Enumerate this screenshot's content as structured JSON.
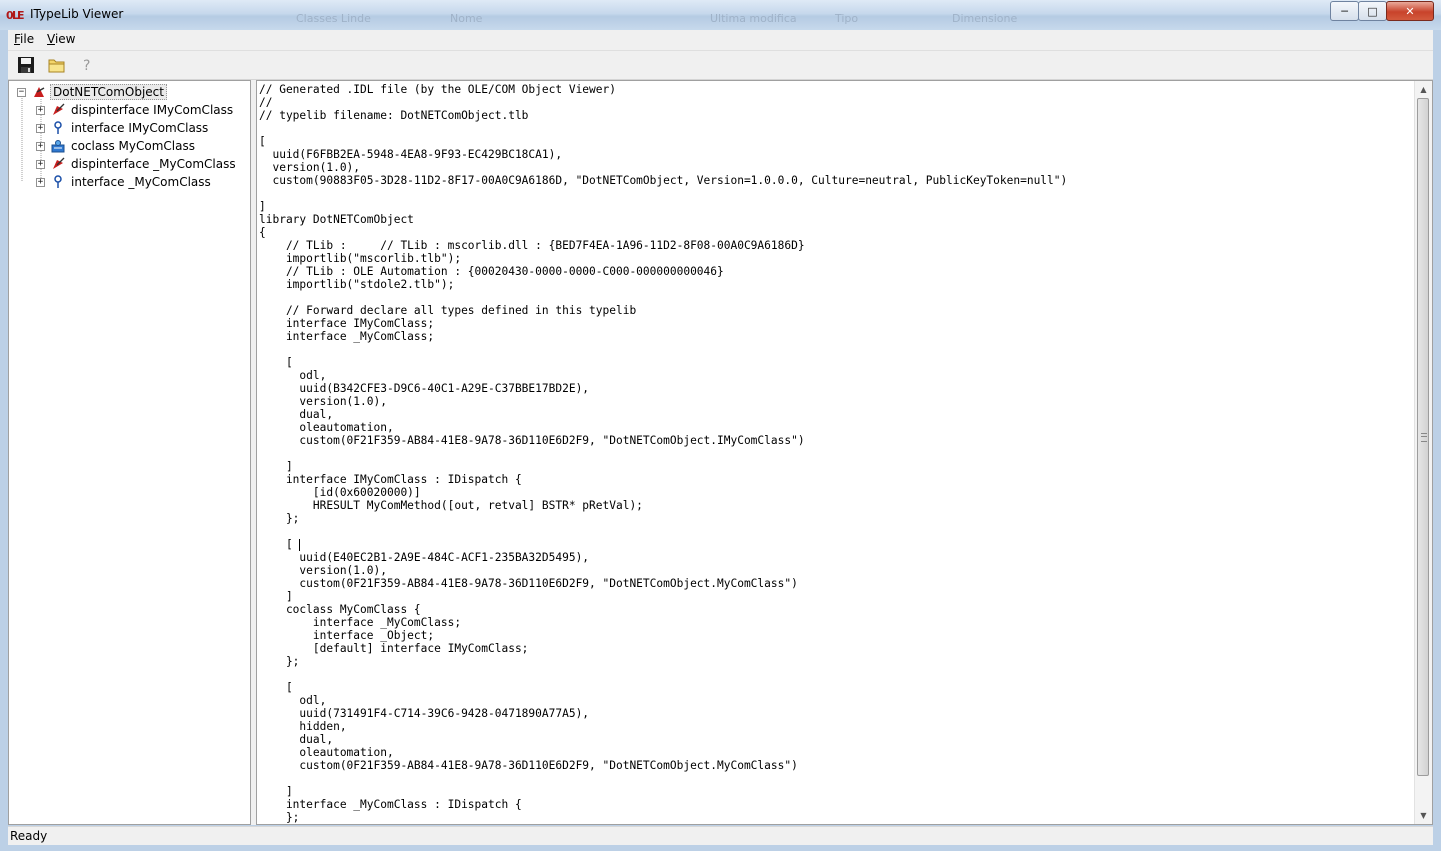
{
  "window": {
    "title": "ITypeLib Viewer",
    "buttons": {
      "minimize": "─",
      "maximize": "□",
      "close": "✕"
    },
    "background_ghost": [
      "Classes Linde",
      "Nome",
      "Ultima modifica",
      "Tipo",
      "Dimensione"
    ]
  },
  "menu": {
    "items": [
      {
        "accel": "F",
        "rest": "ile"
      },
      {
        "accel": "V",
        "rest": "iew"
      }
    ]
  },
  "toolbar": {
    "icons": [
      "save-icon",
      "open-folder-icon",
      "help-icon"
    ]
  },
  "tree": {
    "root": {
      "label": "DotNETComObject",
      "expander": "−",
      "icon": "typelib-icon"
    },
    "children": [
      {
        "label": "dispinterface IMyComClass",
        "expander": "+",
        "icon": "dispinterface-icon"
      },
      {
        "label": "interface IMyComClass",
        "expander": "+",
        "icon": "interface-icon"
      },
      {
        "label": "coclass MyComClass",
        "expander": "+",
        "icon": "coclass-icon"
      },
      {
        "label": "dispinterface _MyComClass",
        "expander": "+",
        "icon": "dispinterface-icon"
      },
      {
        "label": "interface _MyComClass",
        "expander": "+",
        "icon": "interface-icon"
      }
    ]
  },
  "code": {
    "text": "// Generated .IDL file (by the OLE/COM Object Viewer)\n// \n// typelib filename: DotNETComObject.tlb\n\n[\n  uuid(F6FBB2EA-5948-4EA8-9F93-EC429BC18CA1),\n  version(1.0),\n  custom(90883F05-3D28-11D2-8F17-00A0C9A6186D, \"DotNETComObject, Version=1.0.0.0, Culture=neutral, PublicKeyToken=null\")\n\n]\nlibrary DotNETComObject\n{\n    // TLib :     // TLib : mscorlib.dll : {BED7F4EA-1A96-11D2-8F08-00A0C9A6186D}\n    importlib(\"mscorlib.tlb\");\n    // TLib : OLE Automation : {00020430-0000-0000-C000-000000000046}\n    importlib(\"stdole2.tlb\");\n\n    // Forward declare all types defined in this typelib\n    interface IMyComClass;\n    interface _MyComClass;\n\n    [\n      odl,\n      uuid(B342CFE3-D9C6-40C1-A29E-C37BBE17BD2E),\n      version(1.0),\n      dual,\n      oleautomation,\n      custom(0F21F359-AB84-41E8-9A78-36D110E6D2F9, \"DotNETComObject.IMyComClass\")\n\n    ]\n    interface IMyComClass : IDispatch {\n        [id(0x60020000)]\n        HRESULT MyComMethod([out, retval] BSTR* pRetVal);\n    };\n\n    [\n      uuid(E40EC2B1-2A9E-484C-ACF1-235BA32D5495),\n      version(1.0),\n      custom(0F21F359-AB84-41E8-9A78-36D110E6D2F9, \"DotNETComObject.MyComClass\")\n    ]\n    coclass MyComClass {\n        interface _MyComClass;\n        interface _Object;\n        [default] interface IMyComClass;\n    };\n\n    [\n      odl,\n      uuid(731491F4-C714-39C6-9428-0471890A77A5),\n      hidden,\n      dual,\n      oleautomation,\n      custom(0F21F359-AB84-41E8-9A78-36D110E6D2F9, \"DotNETComObject.MyComClass\")\n\n    ]\n    interface _MyComClass : IDispatch {\n    };"
  },
  "scrollbar": {
    "up": "▲",
    "down": "▼"
  },
  "status": {
    "text": "Ready"
  }
}
